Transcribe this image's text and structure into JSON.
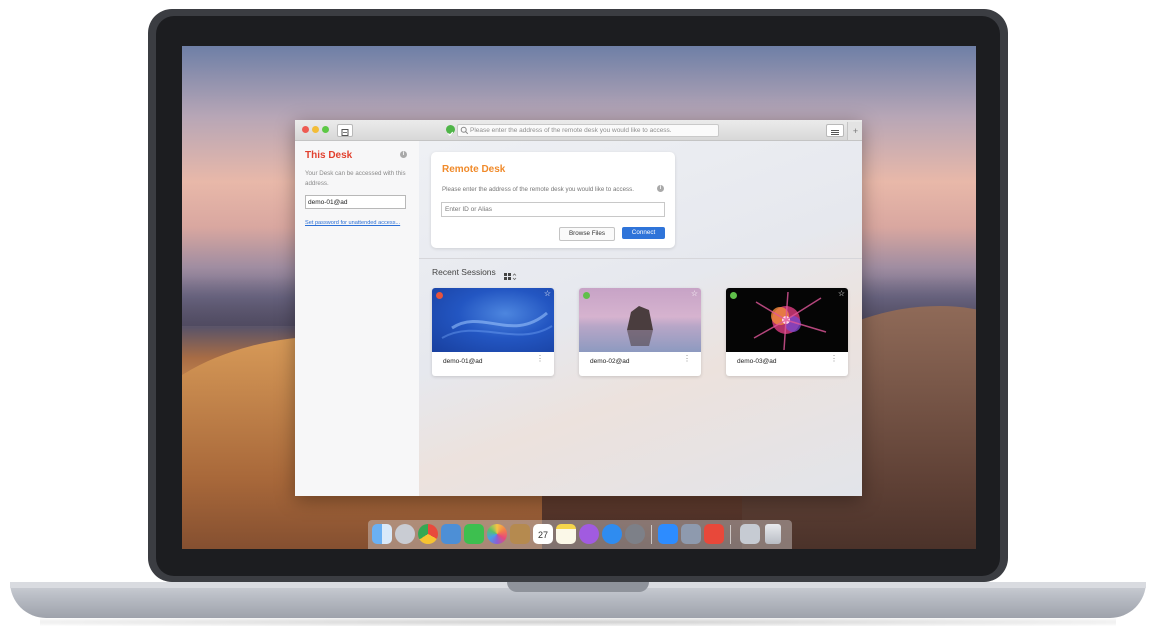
{
  "window": {
    "address_placeholder": "Please enter the address of the remote desk you would like to access.",
    "menu_icon": "hamburger-menu-icon",
    "new_tab_label": "+"
  },
  "sidebar": {
    "title": "This Desk",
    "description": "Your Desk can be accessed with this address.",
    "address_value": "demo-01@ad",
    "password_link": "Set password for unattended access..."
  },
  "remote_desk": {
    "title": "Remote Desk",
    "instruction": "Please enter the address of the remote desk you would like to access.",
    "input_placeholder": "Enter ID or Alias",
    "browse_label": "Browse Files",
    "connect_label": "Connect"
  },
  "recent_sessions": {
    "title": "Recent Sessions",
    "view_icon": "grid-view-icon",
    "items": [
      {
        "name": "demo-01@ad",
        "status_color": "#e5533d"
      },
      {
        "name": "demo-02@ad",
        "status_color": "#5fbf4a"
      },
      {
        "name": "demo-03@ad",
        "status_color": "#5fbf4a"
      }
    ]
  },
  "colors": {
    "this_desk_title": "#e2412f",
    "remote_desk_title": "#f08a2a",
    "connect_button": "#2f74d9",
    "link": "#2a6fd6"
  },
  "dock": {
    "apps": [
      "finder-icon",
      "launchpad-icon",
      "chrome-icon",
      "preview-icon",
      "facetime-icon",
      "photos-icon",
      "contacts-icon",
      "calendar-icon",
      "notes-icon",
      "podcasts-icon",
      "app-store-icon",
      "system-preferences-icon",
      "zoom-icon",
      "photo-booth-icon",
      "anydesk-icon",
      "downloads-icon",
      "trash-icon"
    ],
    "calendar_day": "27"
  }
}
